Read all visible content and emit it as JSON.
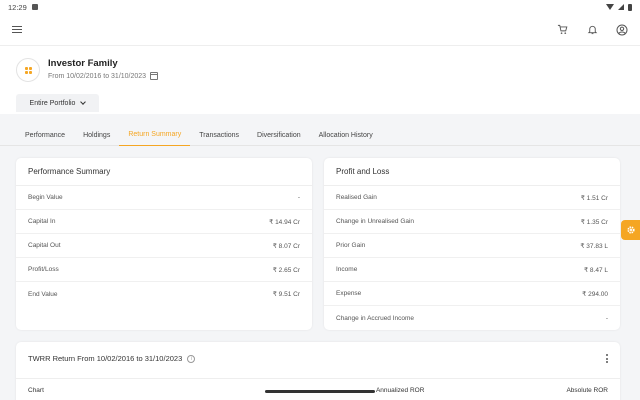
{
  "status_bar": {
    "time": "12:29"
  },
  "app_bar": {
    "icons": [
      "menu-icon",
      "cart-icon",
      "bell-icon",
      "account-icon"
    ]
  },
  "header": {
    "family_name": "Investor Family",
    "date_range": "From 10/02/2016 to 31/10/2023",
    "portfolio_select": "Entire Portfolio"
  },
  "tabs": [
    {
      "label": "Performance",
      "active": false
    },
    {
      "label": "Holdings",
      "active": false
    },
    {
      "label": "Return Summary",
      "active": true
    },
    {
      "label": "Transactions",
      "active": false
    },
    {
      "label": "Diversification",
      "active": false
    },
    {
      "label": "Allocation History",
      "active": false
    }
  ],
  "performance_summary": {
    "title": "Performance Summary",
    "rows": [
      {
        "label": "Begin Value",
        "value": "-"
      },
      {
        "label": "Capital In",
        "value": "₹ 14.94 Cr"
      },
      {
        "label": "Capital Out",
        "value": "₹ 8.07 Cr"
      },
      {
        "label": "Profit/Loss",
        "value": "₹ 2.65 Cr"
      },
      {
        "label": "End Value",
        "value": "₹ 9.51 Cr"
      }
    ]
  },
  "profit_and_loss": {
    "title": "Profit and Loss",
    "rows": [
      {
        "label": "Realised Gain",
        "value": "₹ 1.51 Cr"
      },
      {
        "label": "Change in Unrealised Gain",
        "value": "₹ 1.35 Cr"
      },
      {
        "label": "Prior Gain",
        "value": "₹ 37.83 L"
      },
      {
        "label": "Income",
        "value": "₹ 8.47 L"
      },
      {
        "label": "Expense",
        "value": "₹ 294.00"
      },
      {
        "label": "Change in Accrued Income",
        "value": "-"
      }
    ]
  },
  "twrr": {
    "title": "TWRR Return From 10/02/2016 to 31/10/2023",
    "columns": [
      "Chart",
      "Annualized ROR",
      "Absolute ROR"
    ]
  },
  "colors": {
    "accent": "#f5a623",
    "background": "#f4f5f7",
    "card": "#ffffff"
  }
}
